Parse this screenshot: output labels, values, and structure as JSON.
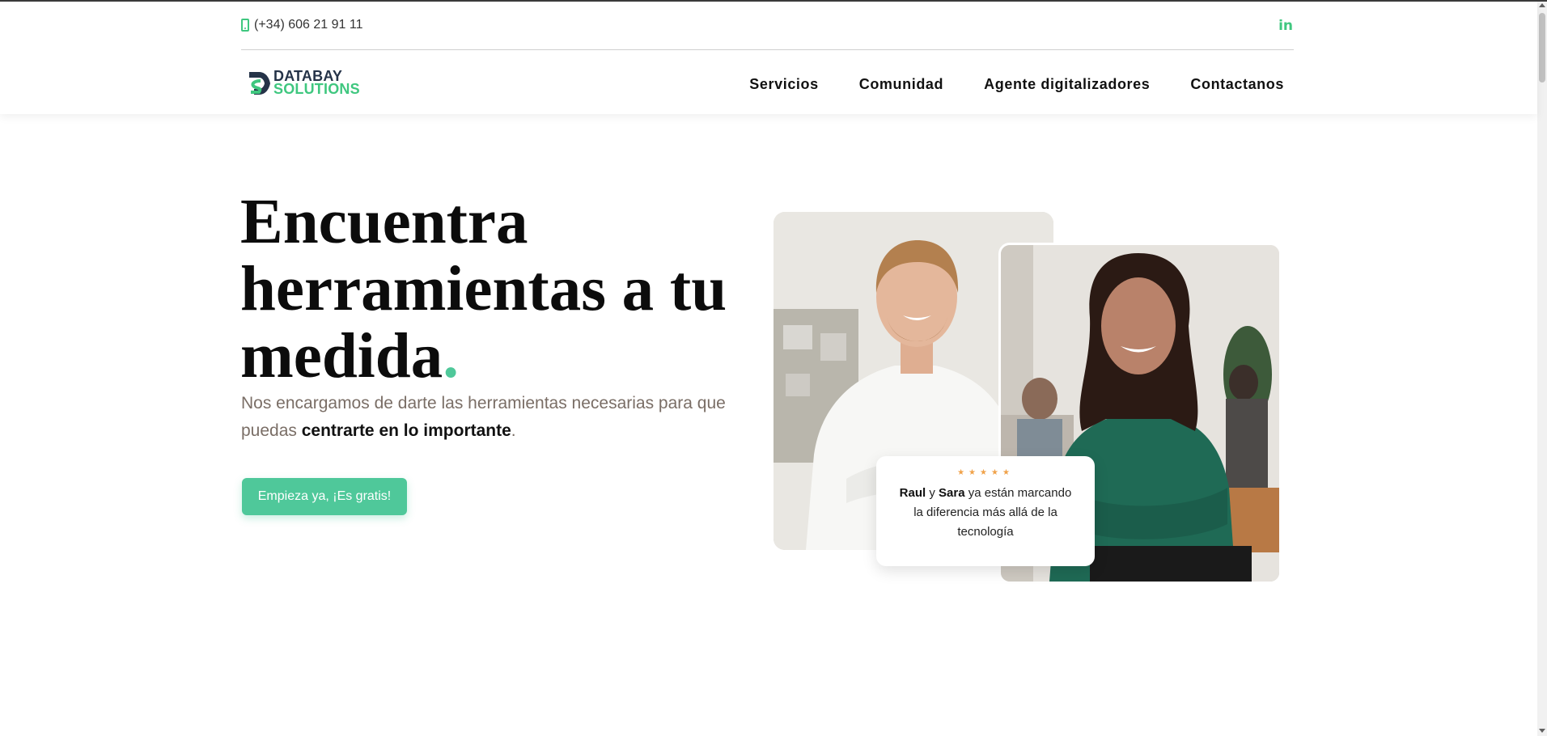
{
  "topbar": {
    "phone": "(+34) 606 21 91 11",
    "phone_icon": "mobile-phone-icon",
    "social": "in",
    "social_icon": "linkedin-icon"
  },
  "brand": {
    "line1": "DATABAY",
    "line2": "SOLUTIONS",
    "colors": {
      "dark": "#253348",
      "accent": "#3fc77f"
    }
  },
  "nav": {
    "items": [
      "Servicios",
      "Comunidad",
      "Agente digitalizadores",
      "Contactanos"
    ]
  },
  "hero": {
    "title": "Encuentra herramientas a tu medida",
    "title_dot": ".",
    "subtitle_pre": "Nos encargamos de darte las herramientas necesarias para que puedas ",
    "subtitle_bold": "centrarte en lo importante",
    "subtitle_post": ".",
    "cta": "Empieza ya, ¡Es gratis!",
    "accent_color": "#4fc89a"
  },
  "review": {
    "stars": "★★★★★",
    "name1": "Raul",
    "conj": " y ",
    "name2": "Sara",
    "text": " ya están marcando la diferencia más allá de la tecnología"
  }
}
